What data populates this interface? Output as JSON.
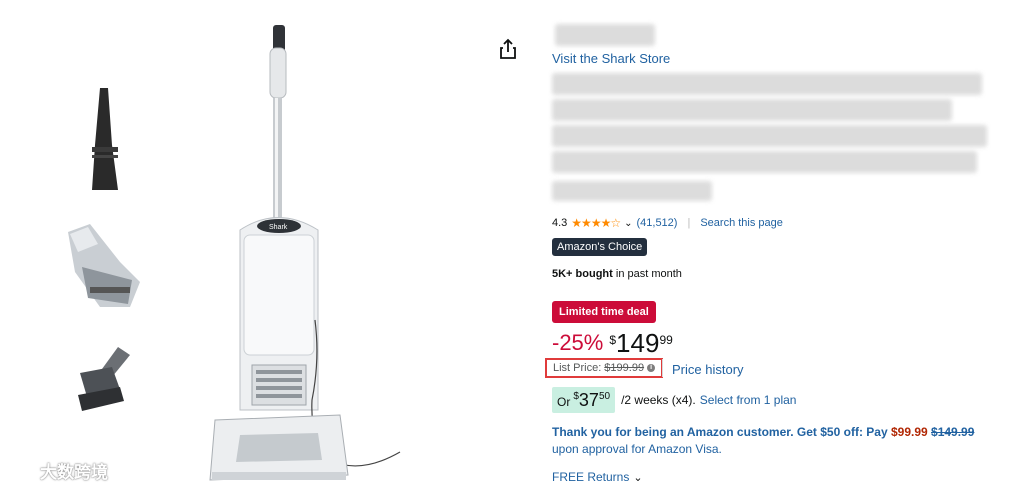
{
  "store_link": "Visit the Shark Store",
  "rating": {
    "value": "4.3",
    "stars": "★★★★☆",
    "count": "(41,512)",
    "search_page": "Search this page"
  },
  "badge": "Amazon's Choice",
  "bought": {
    "strong": "5K+ bought",
    "rest": " in past month"
  },
  "deal_label": "Limited time deal",
  "price": {
    "discount": "-25%",
    "currency": "$",
    "whole": "149",
    "fraction": "99"
  },
  "list_price": {
    "label": "List Price:",
    "value": "$199.99",
    "info": "i"
  },
  "price_history": "Price history",
  "installment": {
    "or": "Or",
    "currency": "$",
    "whole": "37",
    "fraction": "50",
    "terms": "/2 weeks (x4).",
    "plan_link": "Select from 1 plan"
  },
  "promo": {
    "lead": "Thank you for being an Amazon customer. Get $50 off: Pay",
    "new_price": "$99.99",
    "old_price": "$149.99",
    "tail": "upon approval for Amazon Visa."
  },
  "returns": "FREE Returns",
  "watermark": "大数跨境",
  "colors": {
    "link": "#2162a1",
    "deal": "#cc0c39",
    "highlight_box": "#e03b3b",
    "badge_bg": "#232f3e",
    "installment_bg": "#c9efe1"
  }
}
